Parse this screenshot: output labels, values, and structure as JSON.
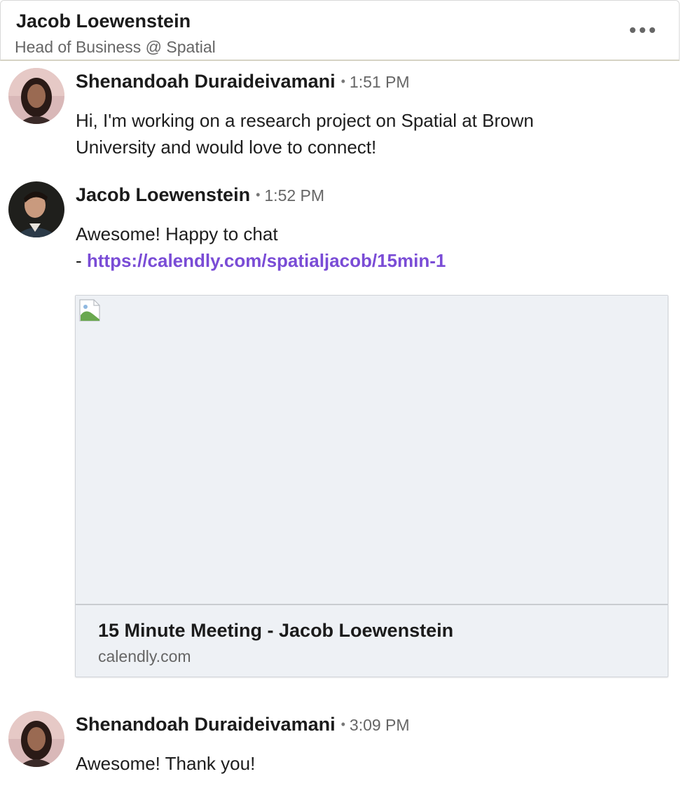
{
  "header": {
    "name": "Jacob Loewenstein",
    "subtitle": "Head of Business @ Spatial"
  },
  "messages": [
    {
      "sender": "Shenandoah Duraideivamani",
      "separator": "•",
      "time": "1:51 PM",
      "lines": [
        "Hi, I'm working on a research project on Spatial at Brown",
        "University and would love to connect!"
      ]
    },
    {
      "sender": "Jacob Loewenstein",
      "separator": "•",
      "time": "1:52 PM",
      "line1": "Awesome! Happy to chat",
      "link_prefix": "- ",
      "link": "https://calendly.com/spatialjacob/15min-1",
      "card": {
        "title": "15 Minute Meeting - Jacob Loewenstein",
        "domain": "calendly.com"
      }
    },
    {
      "sender": "Shenandoah Duraideivamani",
      "separator": "•",
      "time": "3:09 PM",
      "text": "Awesome! Thank you!"
    }
  ]
}
